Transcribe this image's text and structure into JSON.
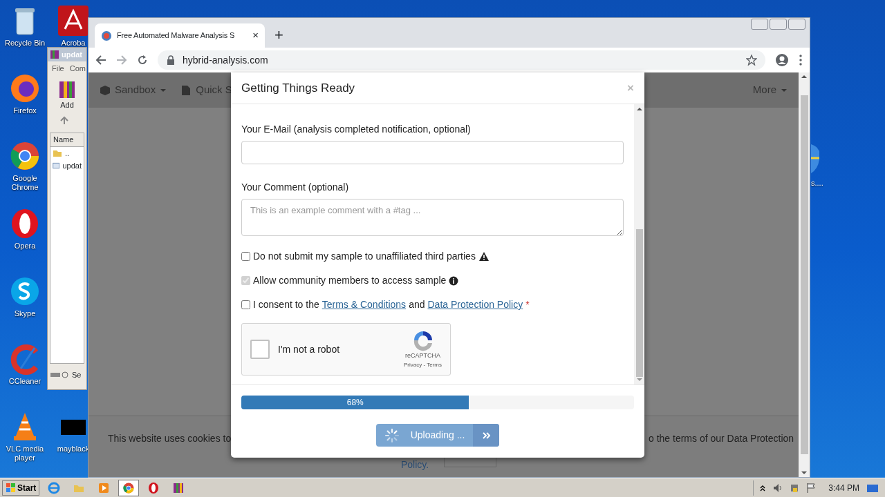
{
  "desktop_icons": [
    {
      "label": "Recycle Bin",
      "kind": "recycle"
    },
    {
      "label": "Acroba",
      "kind": "acrobat"
    },
    {
      "label": "Firefox",
      "kind": "firefox"
    },
    {
      "label": "Google Chrome",
      "kind": "chrome"
    },
    {
      "label": "Opera",
      "kind": "opera"
    },
    {
      "label": "Skype",
      "kind": "skype"
    },
    {
      "label": "CCleaner",
      "kind": "ccleaner"
    },
    {
      "label": "VLC media player",
      "kind": "vlc"
    },
    {
      "label": "mayblack",
      "kind": "black"
    }
  ],
  "right_icon": {
    "label": "s...."
  },
  "winrar": {
    "title": "updat",
    "menu": [
      "File",
      "Com"
    ],
    "toolbar": [
      "Add"
    ],
    "column": "Name",
    "rows": [
      {
        "label": "..",
        "kind": "folder"
      },
      {
        "label": "updat",
        "kind": "file"
      }
    ],
    "status": "Se"
  },
  "browser": {
    "tab": {
      "title": "Free Automated Malware Analysis S",
      "close": "×"
    },
    "new_tab": "+",
    "url": "hybrid-analysis.com"
  },
  "page": {
    "nav": [
      {
        "label": "Sandbox",
        "kind": "cube"
      },
      {
        "label": "Quick S",
        "kind": "file"
      }
    ],
    "more": "More",
    "cookie": {
      "text_left": "This website uses cookies to",
      "text_right": "o the terms of our Data Protection",
      "policy": "Policy."
    }
  },
  "modal": {
    "title": "Getting Things Ready",
    "close": "×",
    "email_label": "Your E-Mail (analysis completed notification, optional)",
    "comment_label": "Your Comment (optional)",
    "comment_placeholder": "This is an example comment with a #tag ...",
    "checkboxes": [
      {
        "kind": "warning",
        "checked": false,
        "disabled": false,
        "parts": [
          "Do not submit my sample to unaffiliated third parties"
        ]
      },
      {
        "kind": "info",
        "checked": true,
        "disabled": true,
        "parts": [
          "Allow community members to access sample"
        ]
      },
      {
        "kind": "consent",
        "checked": false,
        "disabled": false,
        "parts": [
          "I consent to the",
          "Terms & Conditions",
          "and",
          "Data Protection Policy",
          "*"
        ]
      }
    ],
    "captcha": {
      "label": "I'm not a robot",
      "brand": "reCAPTCHA",
      "links": "Privacy - Terms",
      "checked": false
    },
    "progress": {
      "label": "68%",
      "level": 0.58
    },
    "upload_button": "Uploading ..."
  },
  "taskbar": {
    "start": "Start",
    "apps": [
      {
        "kind": "ie",
        "selected": false
      },
      {
        "kind": "explorer",
        "selected": false
      },
      {
        "kind": "media",
        "selected": false
      },
      {
        "kind": "chrome",
        "selected": true
      },
      {
        "kind": "opera",
        "selected": false
      },
      {
        "kind": "winrar",
        "selected": false
      }
    ],
    "clock": "3:44 PM"
  }
}
